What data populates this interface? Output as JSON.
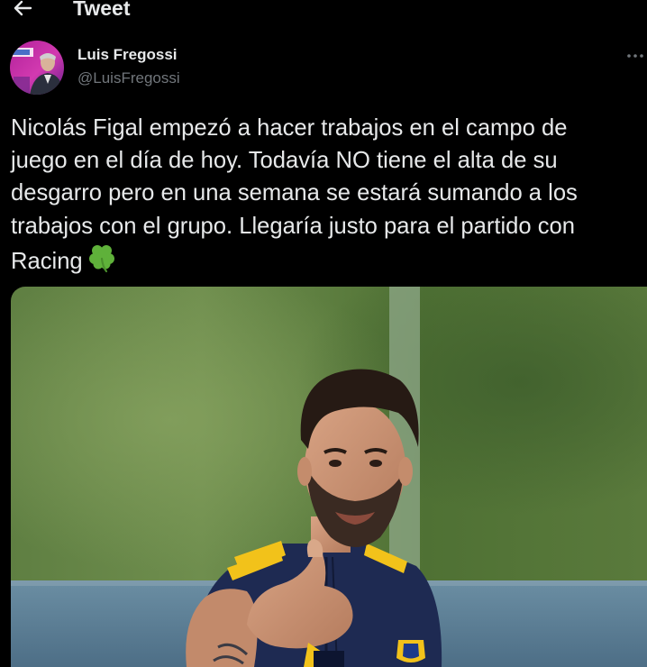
{
  "header": {
    "title": "Tweet",
    "back_icon": "arrow-left-icon"
  },
  "author": {
    "name": "Luis Fregossi",
    "handle": "@LuisFregossi",
    "avatar_icon": "avatar-image"
  },
  "more_icon": "more-horizontal-icon",
  "tweet": {
    "lines": [
      "Nicolás Figal empezó a hacer trabajos en el campo de",
      "juego en el día de hoy. Todavía NO tiene el alta de su",
      "desgarro pero en una semana se estará sumando a los",
      "trabajos con el grupo. Llegaría justo para el partido con",
      "Racing"
    ],
    "emoji": "shamrock-emoji"
  },
  "media": {
    "description_icon": "player-photo"
  },
  "colors": {
    "background": "#000000",
    "text": "#e7e9ea",
    "secondary_text": "#71767b"
  }
}
